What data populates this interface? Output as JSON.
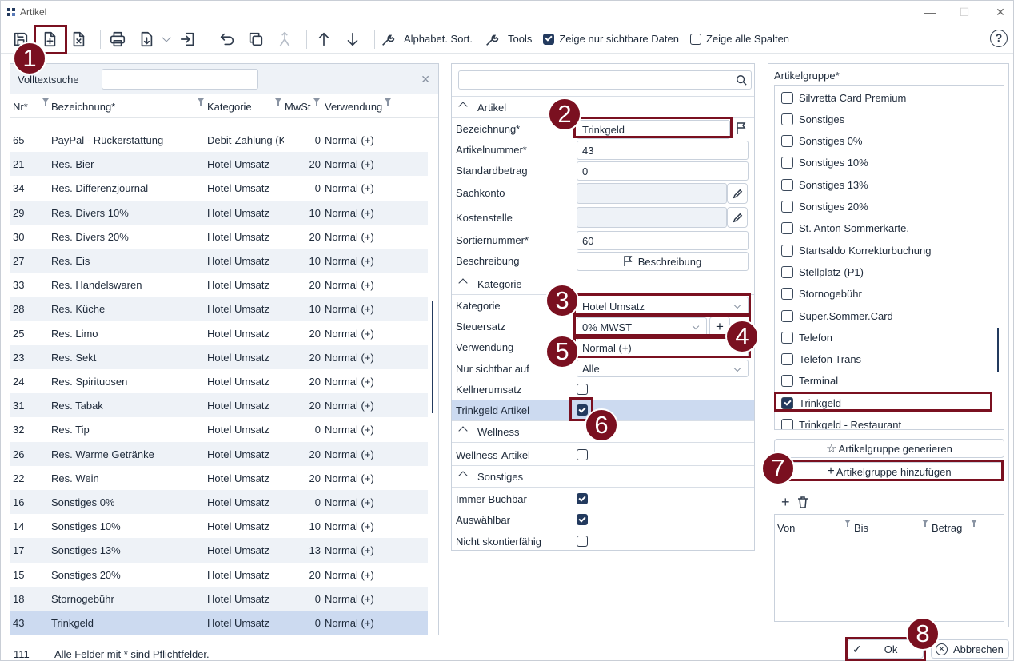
{
  "window": {
    "title": "Artikel"
  },
  "toolbar": {
    "alpha_sort": "Alphabet. Sort.",
    "tools": "Tools",
    "show_visible": "Zeige nur sichtbare Daten",
    "show_visible_checked": true,
    "show_all_columns": "Zeige alle Spalten",
    "show_all_columns_checked": false
  },
  "left": {
    "search_label": "Volltextsuche",
    "search_value": "",
    "columns": {
      "nr": "Nr*",
      "bez": "Bezeichnung*",
      "kat": "Kategorie",
      "mwst": "MwSt",
      "verw": "Verwendung"
    },
    "rows": [
      {
        "nr": "65",
        "bez": "PayPal - Rückerstattung",
        "kat": "Debit-Zahlung (K",
        "mwst": "0",
        "verw": "Normal (+)"
      },
      {
        "nr": "21",
        "bez": "Res. Bier",
        "kat": "Hotel Umsatz",
        "mwst": "20",
        "verw": "Normal (+)"
      },
      {
        "nr": "34",
        "bez": "Res. Differenzjournal",
        "kat": "Hotel Umsatz",
        "mwst": "0",
        "verw": "Normal (+)"
      },
      {
        "nr": "29",
        "bez": "Res. Divers 10%",
        "kat": "Hotel Umsatz",
        "mwst": "10",
        "verw": "Normal (+)"
      },
      {
        "nr": "30",
        "bez": "Res. Divers 20%",
        "kat": "Hotel Umsatz",
        "mwst": "20",
        "verw": "Normal (+)"
      },
      {
        "nr": "27",
        "bez": "Res. Eis",
        "kat": "Hotel Umsatz",
        "mwst": "10",
        "verw": "Normal (+)"
      },
      {
        "nr": "33",
        "bez": "Res. Handelswaren",
        "kat": "Hotel Umsatz",
        "mwst": "20",
        "verw": "Normal (+)"
      },
      {
        "nr": "28",
        "bez": "Res. Küche",
        "kat": "Hotel Umsatz",
        "mwst": "10",
        "verw": "Normal (+)"
      },
      {
        "nr": "25",
        "bez": "Res. Limo",
        "kat": "Hotel Umsatz",
        "mwst": "20",
        "verw": "Normal (+)"
      },
      {
        "nr": "23",
        "bez": "Res. Sekt",
        "kat": "Hotel Umsatz",
        "mwst": "20",
        "verw": "Normal (+)"
      },
      {
        "nr": "24",
        "bez": "Res. Spirituosen",
        "kat": "Hotel Umsatz",
        "mwst": "20",
        "verw": "Normal (+)"
      },
      {
        "nr": "31",
        "bez": "Res. Tabak",
        "kat": "Hotel Umsatz",
        "mwst": "20",
        "verw": "Normal (+)"
      },
      {
        "nr": "32",
        "bez": "Res. Tip",
        "kat": "Hotel Umsatz",
        "mwst": "0",
        "verw": "Normal (+)"
      },
      {
        "nr": "26",
        "bez": "Res. Warme Getränke",
        "kat": "Hotel Umsatz",
        "mwst": "20",
        "verw": "Normal (+)"
      },
      {
        "nr": "22",
        "bez": "Res. Wein",
        "kat": "Hotel Umsatz",
        "mwst": "20",
        "verw": "Normal (+)"
      },
      {
        "nr": "16",
        "bez": "Sonstiges 0%",
        "kat": "Hotel Umsatz",
        "mwst": "0",
        "verw": "Normal (+)"
      },
      {
        "nr": "14",
        "bez": "Sonstiges 10%",
        "kat": "Hotel Umsatz",
        "mwst": "10",
        "verw": "Normal (+)"
      },
      {
        "nr": "17",
        "bez": "Sonstiges 13%",
        "kat": "Hotel Umsatz",
        "mwst": "13",
        "verw": "Normal (+)"
      },
      {
        "nr": "15",
        "bez": "Sonstiges 20%",
        "kat": "Hotel Umsatz",
        "mwst": "20",
        "verw": "Normal (+)"
      },
      {
        "nr": "18",
        "bez": "Stornogebühr",
        "kat": "Hotel Umsatz",
        "mwst": "0",
        "verw": "Normal (+)"
      },
      {
        "nr": "43",
        "bez": "Trinkgeld",
        "kat": "Hotel Umsatz",
        "mwst": "0",
        "verw": "Normal (+)"
      }
    ],
    "count": "111",
    "required_note": "Alle Felder mit * sind Pflichtfelder."
  },
  "form": {
    "sec_artikel": "Artikel",
    "bez_label": "Bezeichnung*",
    "bez_value": "Trinkgeld",
    "artnr_label": "Artikelnummer*",
    "artnr_value": "43",
    "std_label": "Standardbetrag",
    "std_value": "0",
    "sach_label": "Sachkonto",
    "kost_label": "Kostenstelle",
    "sort_label": "Sortiernummer*",
    "sort_value": "60",
    "besch_label": "Beschreibung",
    "besch_button": "Beschreibung",
    "sec_kategorie": "Kategorie",
    "kat_label": "Kategorie",
    "kat_value": "Hotel Umsatz",
    "steuer_label": "Steuersatz",
    "steuer_value": "0% MWST",
    "verw_label": "Verwendung",
    "verw_value": "Normal (+)",
    "nur_label": "Nur sichtbar auf",
    "nur_value": "Alle",
    "kellner_label": "Kellnerumsatz",
    "kellner_checked": false,
    "tg_label": "Trinkgeld Artikel",
    "tg_checked": true,
    "sec_wellness": "Wellness",
    "well_label": "Wellness-Artikel",
    "well_checked": false,
    "sec_sonstiges": "Sonstiges",
    "immer_label": "Immer Buchbar",
    "immer_checked": true,
    "ausw_label": "Auswählbar",
    "ausw_checked": true,
    "nicht_label": "Nicht skontierfähig",
    "nicht_checked": false
  },
  "groups": {
    "header": "Artikelgruppe*",
    "items": [
      {
        "label": "Silvretta Card Premium",
        "checked": false
      },
      {
        "label": "Sonstiges",
        "checked": false
      },
      {
        "label": "Sonstiges 0%",
        "checked": false
      },
      {
        "label": "Sonstiges 10%",
        "checked": false
      },
      {
        "label": "Sonstiges 13%",
        "checked": false
      },
      {
        "label": "Sonstiges 20%",
        "checked": false
      },
      {
        "label": "St. Anton Sommerkarte.",
        "checked": false
      },
      {
        "label": "Startsaldo Korrekturbuchung",
        "checked": false
      },
      {
        "label": "Stellplatz (P1)",
        "checked": false
      },
      {
        "label": "Stornogebühr",
        "checked": false
      },
      {
        "label": "Super.Sommer.Card",
        "checked": false
      },
      {
        "label": "Telefon",
        "checked": false
      },
      {
        "label": "Telefon Trans",
        "checked": false
      },
      {
        "label": "Terminal",
        "checked": false
      },
      {
        "label": "Trinkgeld",
        "checked": true
      },
      {
        "label": "Trinkgeld - Restaurant",
        "checked": false
      }
    ],
    "generate": "Artikelgruppe generieren",
    "add": "Artikelgruppe hinzufügen",
    "tbl_von": "Von",
    "tbl_bis": "Bis",
    "tbl_betrag": "Betrag"
  },
  "footer": {
    "ok": "Ok",
    "cancel": "Abbrechen"
  },
  "badges": [
    "1",
    "2",
    "3",
    "4",
    "5",
    "6",
    "7",
    "8"
  ],
  "colors": {
    "accent": "#233a5e",
    "highlight": "#7a1020",
    "selected_row": "#ccdaf0",
    "alt_row": "#eef2f7"
  }
}
